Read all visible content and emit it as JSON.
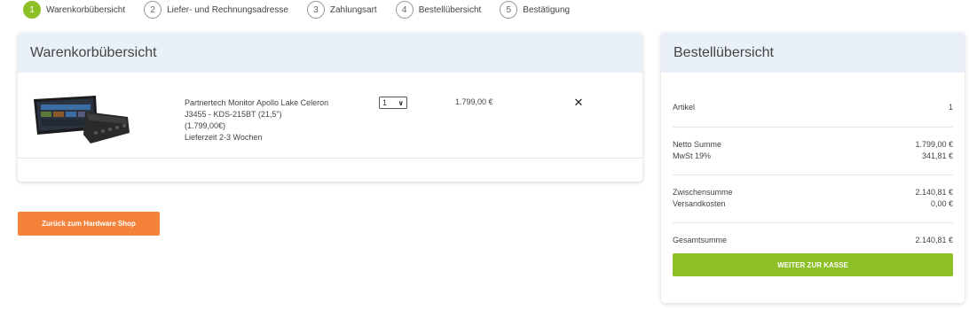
{
  "steps": [
    {
      "num": "1",
      "label": "Warenkorbübersicht"
    },
    {
      "num": "2",
      "label": "Liefer- und Rechnungsadresse"
    },
    {
      "num": "3",
      "label": "Zahlungsart"
    },
    {
      "num": "4",
      "label": "Bestellübersicht"
    },
    {
      "num": "5",
      "label": "Bestätigung"
    }
  ],
  "cart": {
    "title": "Warenkorbübersicht",
    "item": {
      "name_line1": "Partnertech Monitor Apollo Lake Celeron",
      "name_line2": "J3455 - KDS-215BT (21,5\")",
      "unit_price": "(1.799,00€)",
      "delivery": "Lieferzeit 2-3 Wochen",
      "quantity": "1",
      "price": "1.799,00 €",
      "image_icon": "product-monitor-image",
      "remove_icon": "close-icon"
    }
  },
  "back_button": "Zurück zum Hardware Shop",
  "summary": {
    "title": "Bestellübersicht",
    "article_label": "Artikel",
    "article_count": "1",
    "net_label": "Netto Summe",
    "net_value": "1.799,00 €",
    "vat_label": "MwSt 19%",
    "vat_value": "341,81 €",
    "subtotal_label": "Zwischensumme",
    "subtotal_value": "2.140,81 €",
    "shipping_label": "Versandkosten",
    "shipping_value": "0,00 €",
    "total_label": "Gesamtsumme",
    "total_value": "2.140,81 €",
    "checkout_button": "WEITER ZUR KASSE"
  },
  "colors": {
    "accent_green": "#8dbf27",
    "accent_orange": "#f5823a",
    "panel_header": "#eaf0f8"
  }
}
